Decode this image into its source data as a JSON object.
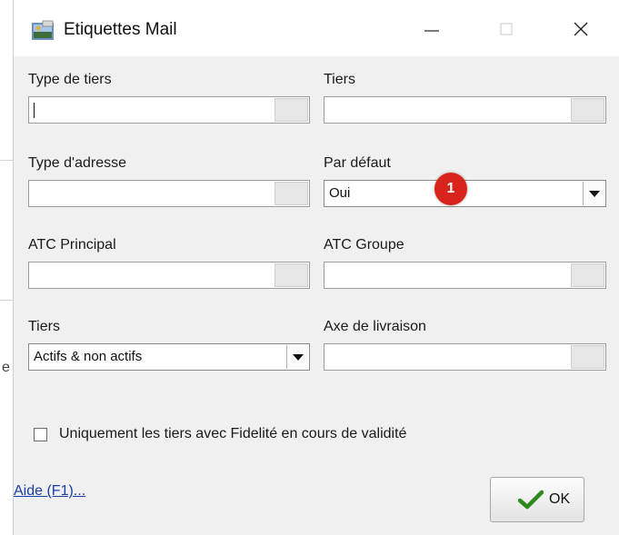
{
  "window": {
    "title": "Etiquettes Mail",
    "app_icon": "app-icon",
    "controls": [
      "minimize-icon",
      "maximize-icon",
      "close-icon"
    ]
  },
  "fields": {
    "type_tiers": {
      "label": "Type de tiers",
      "value": ""
    },
    "tiers": {
      "label": "Tiers",
      "value": ""
    },
    "type_adresse": {
      "label": "Type d'adresse",
      "value": ""
    },
    "par_defaut": {
      "label": "Par défaut",
      "value": "Oui"
    },
    "atc_principal": {
      "label": "ATC Principal",
      "value": ""
    },
    "atc_groupe": {
      "label": "ATC Groupe",
      "value": ""
    },
    "tiers_filter": {
      "label": "Tiers",
      "value": "Actifs & non actifs"
    },
    "axe_livraison": {
      "label": "Axe de livraison",
      "value": ""
    }
  },
  "annotation": {
    "badge": "1",
    "color": "#d9241c"
  },
  "checkbox": {
    "label": "Uniquement les tiers avec Fidelité en cours de validité",
    "checked": false
  },
  "footer": {
    "help": "Aide (F1)...",
    "ok": "OK",
    "ok_icon": "checkmark-icon"
  },
  "colors": {
    "link": "#1a3ea8",
    "check_green": "#2f8a1e"
  }
}
